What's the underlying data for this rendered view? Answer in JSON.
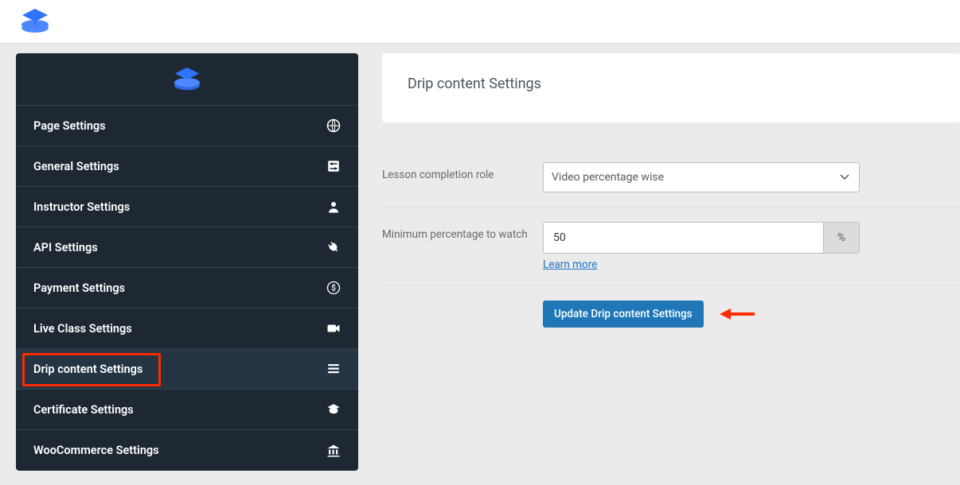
{
  "sidebar": {
    "items": [
      {
        "label": "Page Settings",
        "icon": "globe"
      },
      {
        "label": "General Settings",
        "icon": "sliders"
      },
      {
        "label": "Instructor Settings",
        "icon": "user"
      },
      {
        "label": "API Settings",
        "icon": "plug"
      },
      {
        "label": "Payment Settings",
        "icon": "dollar"
      },
      {
        "label": "Live Class Settings",
        "icon": "video"
      },
      {
        "label": "Drip content Settings",
        "icon": "list",
        "active": true,
        "highlighted": true
      },
      {
        "label": "Certificate Settings",
        "icon": "grad-cap"
      },
      {
        "label": "WooCommerce Settings",
        "icon": "bank"
      }
    ]
  },
  "panel": {
    "title": "Drip content Settings",
    "fields": {
      "lesson_completion": {
        "label": "Lesson completion role",
        "value": "Video percentage wise"
      },
      "min_percentage": {
        "label": "Minimum percentage to watch",
        "value": "50",
        "suffix": "%",
        "learn_more": "Learn more"
      }
    },
    "button": "Update Drip content Settings"
  }
}
